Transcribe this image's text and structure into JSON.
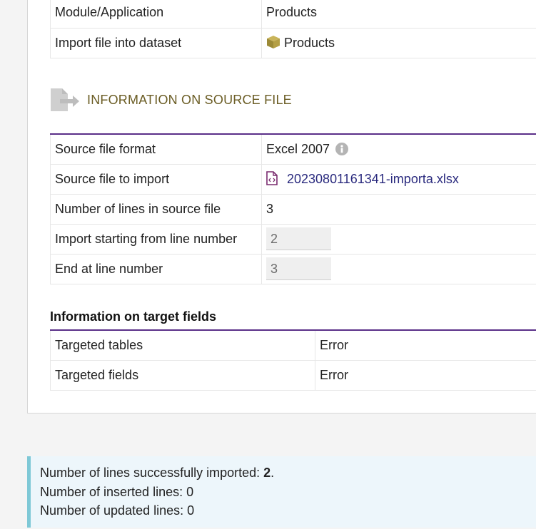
{
  "general": {
    "rows": [
      {
        "label": "Module/Application",
        "value": "Products"
      },
      {
        "label": "Import file into dataset",
        "value": "Products",
        "icon": "box-icon"
      }
    ]
  },
  "source_section": {
    "title": "INFORMATION ON SOURCE FILE",
    "icon": "file-export-icon",
    "format": {
      "label": "Source file format",
      "value": "Excel 2007"
    },
    "file": {
      "label": "Source file to import",
      "value": "20230801161341-importa.xlsx"
    },
    "lines": {
      "label": "Number of lines in source file",
      "value": "3"
    },
    "start": {
      "label": "Import starting from line number",
      "value": "2"
    },
    "end": {
      "label": "End at line number",
      "value": "3"
    }
  },
  "target_section": {
    "title": "Information on target fields",
    "tables": {
      "label": "Targeted tables",
      "value": "Error"
    },
    "fields": {
      "label": "Targeted fields",
      "value": "Error"
    }
  },
  "result": {
    "success_label": "Number of lines successfully imported: ",
    "success_value": "2",
    "success_suffix": ".",
    "inserted": "Number of inserted lines: 0",
    "updated": "Number of updated lines: 0"
  },
  "colors": {
    "accent_border": "#5a2f88",
    "section_title": "#6b5d25",
    "link": "#2a2a7e",
    "result_bg": "#edf6fb",
    "result_border": "#7ec8d6"
  }
}
